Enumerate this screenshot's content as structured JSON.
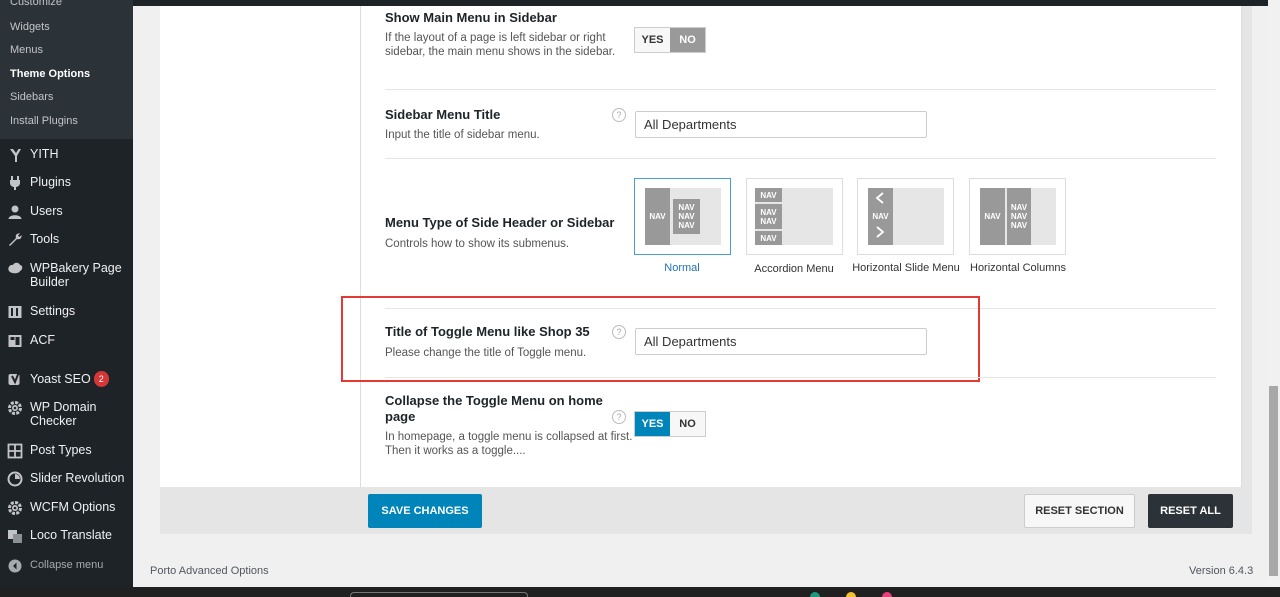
{
  "sidebar": {
    "partial_top_item": "Customize",
    "submenu": [
      "Widgets",
      "Menus",
      "Theme Options",
      "Sidebars",
      "Install Plugins"
    ],
    "active_submenu": "Theme Options",
    "items": [
      {
        "label": "YITH",
        "icon": "yith-icon"
      },
      {
        "label": "Plugins",
        "icon": "plugin-icon"
      },
      {
        "label": "Users",
        "icon": "users-icon"
      },
      {
        "label": "Tools",
        "icon": "wrench-icon"
      },
      {
        "label": "WPBakery Page Builder",
        "icon": "wpbakery-icon"
      },
      {
        "label": "Settings",
        "icon": "settings-icon"
      },
      {
        "label": "ACF",
        "icon": "acf-icon"
      },
      {
        "label": "Yoast SEO",
        "icon": "yoast-icon",
        "badge": "2"
      },
      {
        "label": "WP Domain Checker",
        "icon": "gear-icon"
      },
      {
        "label": "Post Types",
        "icon": "grid-icon"
      },
      {
        "label": "Slider Revolution",
        "icon": "slider-icon"
      },
      {
        "label": "WCFM Options",
        "icon": "gear-icon"
      },
      {
        "label": "Loco Translate",
        "icon": "translate-icon"
      }
    ],
    "collapse_label": "Collapse menu"
  },
  "options": {
    "main_menu_sidebar": {
      "title": "Show Main Menu in Sidebar",
      "desc": "If the layout of a page is left sidebar or right sidebar, the main menu shows in the sidebar.",
      "yes": "YES",
      "no": "NO",
      "value": "NO"
    },
    "sidebar_menu_title": {
      "title": "Sidebar Menu Title",
      "desc": "Input the title of sidebar menu.",
      "value": "All Departments"
    },
    "menu_type": {
      "title": "Menu Type of Side Header or Sidebar",
      "desc": "Controls how to show its submenus.",
      "choices": [
        "Normal",
        "Accordion Menu",
        "Horizontal Slide Menu",
        "Horizontal Columns"
      ],
      "selected": "Normal",
      "nav_text": "NAV"
    },
    "toggle_menu_title": {
      "title": "Title of Toggle Menu like Shop 35",
      "desc": "Please change the title of Toggle menu.",
      "value": "All Departments"
    },
    "collapse_toggle": {
      "title": "Collapse the Toggle Menu on home page",
      "desc": "In homepage, a toggle menu is collapsed at first. Then it works as a toggle....",
      "yes": "YES",
      "no": "NO",
      "value": "YES"
    },
    "help_glyph": "?"
  },
  "actions": {
    "save": "SAVE CHANGES",
    "reset_section": "RESET SECTION",
    "reset_all": "RESET ALL"
  },
  "footer": {
    "left": "Porto Advanced Options",
    "version": "Version 6.4.3"
  },
  "colors": {
    "accent": "#0085ba",
    "highlight": "#e53935",
    "sidebar_bg": "#1d2327"
  }
}
